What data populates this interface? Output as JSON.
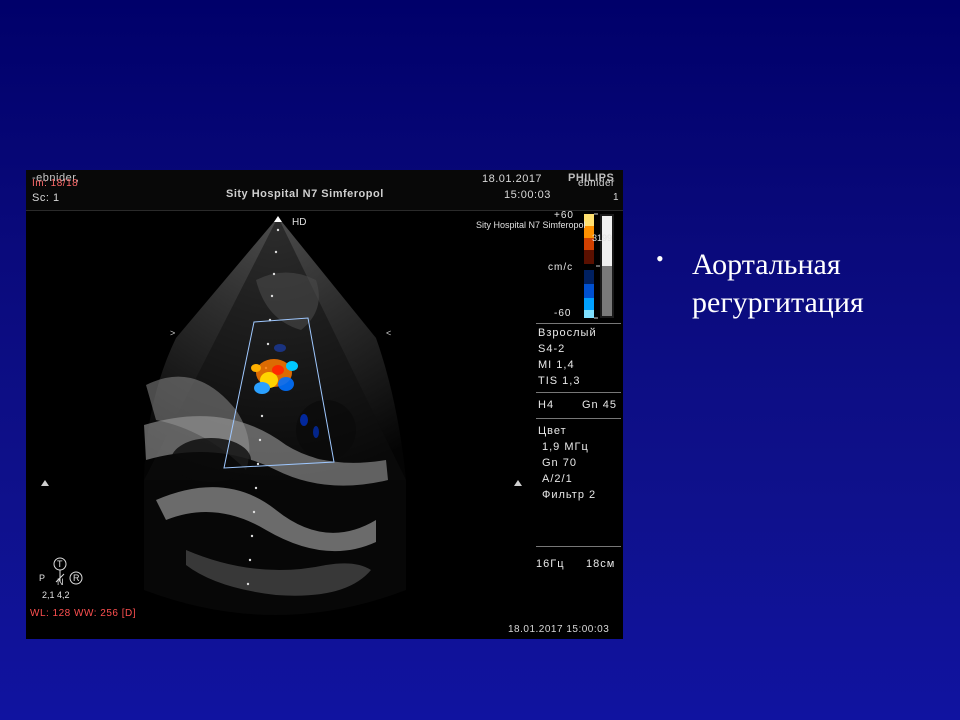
{
  "slide": {
    "bullet_text": "Аортальная регургитация",
    "background_color": "#0a0a7c"
  },
  "ultrasound": {
    "top_left_line1": "-ebnider,",
    "top_left_line2": "Im: 18/18",
    "top_left_line3": "Sc: 1",
    "hospital": "Sity Hospital N7 Simferopol",
    "date": "18.01.2017",
    "time": "15:00:03",
    "brand": "PHILIPS",
    "top_right_name": "ebnider",
    "top_right_num": "1",
    "overlay_hospital": "Sity Hospital N7 Simferopol",
    "overlay_num": "3199",
    "probe_label": "HD",
    "scale_top": "+60",
    "scale_unit": "cm/c",
    "scale_bottom": "-60",
    "panel_lines": [
      "Взрослый",
      "S4-2",
      "MI 1,4",
      "TIS 1,3"
    ],
    "h4": "H4",
    "gn": "Gn 45",
    "color_lines": [
      "Цвет",
      "1,9 МГц",
      "Gn 70",
      "A/2/1",
      "Фильтр 2"
    ],
    "freq": "16Гц",
    "depth": "18см",
    "wl_ww": "WL: 128 WW: 256 [D]",
    "bottom_datetime": "18.01.2017 15:00:03",
    "orient_t": "T",
    "orient_p": "P",
    "orient_r": "R",
    "orient_n": "N",
    "orient_values": "2,1  4,2"
  }
}
